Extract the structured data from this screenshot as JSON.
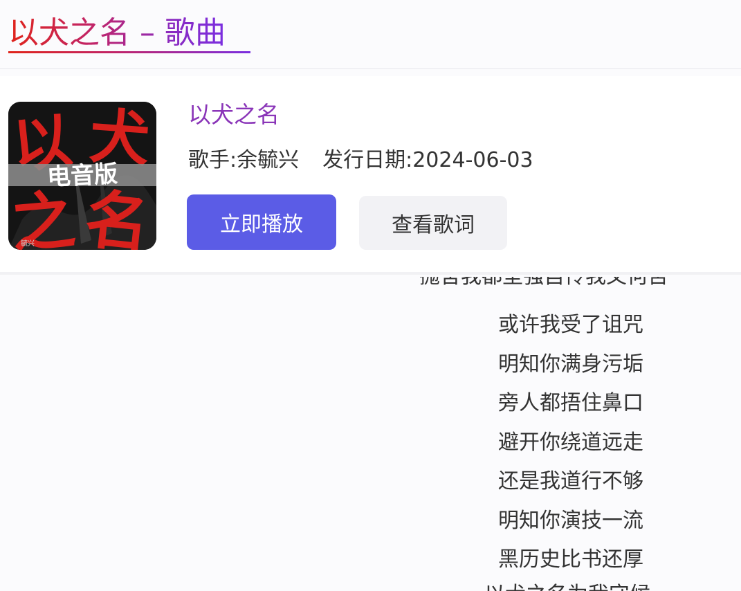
{
  "header": {
    "title": "以犬之名 – 歌曲"
  },
  "song": {
    "name": "以犬之名",
    "artist_line": "歌手:余毓兴",
    "date_line": "发行日期:2024-06-03",
    "cover": {
      "big_chars": [
        "以",
        "犬",
        "之",
        "名"
      ],
      "banner_text": "电音版",
      "small_text": "毓兴",
      "colors": {
        "red": "#d8201c",
        "background": "#141414",
        "banner": "#8c8c8c"
      }
    }
  },
  "actions": {
    "play_label": "立即播放",
    "lyrics_label": "查看歌词"
  },
  "lyrics": {
    "partial_top": "抛舍我都坚强自怜我又何苦",
    "lines": [
      "或许我受了诅咒",
      "明知你满身污垢",
      "旁人都捂住鼻口",
      "避开你绕道远走",
      "还是我道行不够",
      "明知你演技一流",
      "黑历史比书还厚"
    ],
    "partial_bottom": "以犬之名为我守候"
  },
  "colors": {
    "play_button": "#5b5ce6",
    "lyrics_button": "#f2f2f5",
    "song_name": "#8a35b8",
    "title_gradient_start": "#e0241a",
    "title_gradient_end": "#7a2ee0"
  }
}
